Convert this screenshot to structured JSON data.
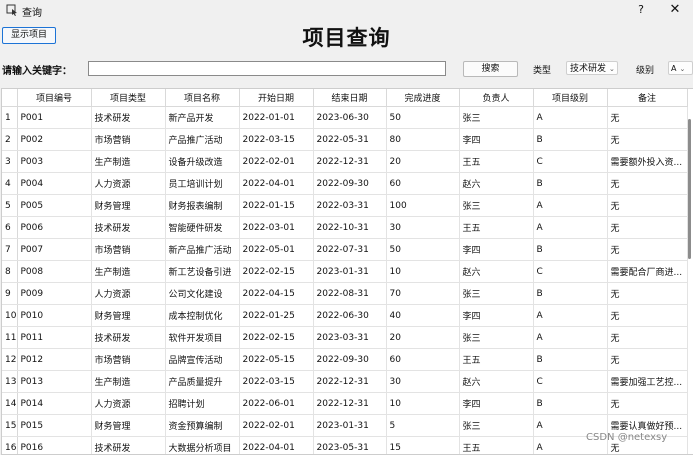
{
  "window": {
    "title": "查询",
    "help": "?",
    "close": "✕"
  },
  "toolbar": {
    "show_button": "显示项目",
    "page_title": "项目查询",
    "keyword_label": "请输入关键字：",
    "keyword_value": "",
    "search_button": "搜索",
    "type_label": "类型",
    "type_selected": "技术研发",
    "level_label": "级别",
    "level_selected": "A"
  },
  "table": {
    "columns": [
      "项目编号",
      "项目类型",
      "项目名称",
      "开始日期",
      "结束日期",
      "完成进度",
      "负责人",
      "项目级别",
      "备注"
    ],
    "rows": [
      [
        "1",
        "P001",
        "技术研发",
        "新产品开发",
        "2022-01-01",
        "2023-06-30",
        "50",
        "张三",
        "A",
        "无"
      ],
      [
        "2",
        "P002",
        "市场营销",
        "产品推广活动",
        "2022-03-15",
        "2022-05-31",
        "80",
        "李四",
        "B",
        "无"
      ],
      [
        "3",
        "P003",
        "生产制造",
        "设备升级改造",
        "2022-02-01",
        "2022-12-31",
        "20",
        "王五",
        "C",
        "需要额外投入资..."
      ],
      [
        "4",
        "P004",
        "人力资源",
        "员工培训计划",
        "2022-04-01",
        "2022-09-30",
        "60",
        "赵六",
        "B",
        "无"
      ],
      [
        "5",
        "P005",
        "财务管理",
        "财务报表编制",
        "2022-01-15",
        "2022-03-31",
        "100",
        "张三",
        "A",
        "无"
      ],
      [
        "6",
        "P006",
        "技术研发",
        "智能硬件研发",
        "2022-03-01",
        "2022-10-31",
        "30",
        "王五",
        "A",
        "无"
      ],
      [
        "7",
        "P007",
        "市场营销",
        "新产品推广活动",
        "2022-05-01",
        "2022-07-31",
        "50",
        "李四",
        "B",
        "无"
      ],
      [
        "8",
        "P008",
        "生产制造",
        "新工艺设备引进",
        "2022-02-15",
        "2023-01-31",
        "10",
        "赵六",
        "C",
        "需要配合厂商进..."
      ],
      [
        "9",
        "P009",
        "人力资源",
        "公司文化建设",
        "2022-04-15",
        "2022-08-31",
        "70",
        "张三",
        "B",
        "无"
      ],
      [
        "10",
        "P010",
        "财务管理",
        "成本控制优化",
        "2022-01-25",
        "2022-06-30",
        "40",
        "李四",
        "A",
        "无"
      ],
      [
        "11",
        "P011",
        "技术研发",
        "软件开发项目",
        "2022-02-15",
        "2023-03-31",
        "20",
        "张三",
        "A",
        "无"
      ],
      [
        "12",
        "P012",
        "市场营销",
        "品牌宣传活动",
        "2022-05-15",
        "2022-09-30",
        "60",
        "王五",
        "B",
        "无"
      ],
      [
        "13",
        "P013",
        "生产制造",
        "产品质量提升",
        "2022-03-15",
        "2022-12-31",
        "30",
        "赵六",
        "C",
        "需要加强工艺控..."
      ],
      [
        "14",
        "P014",
        "人力资源",
        "招聘计划",
        "2022-06-01",
        "2022-12-31",
        "10",
        "李四",
        "B",
        "无"
      ],
      [
        "15",
        "P015",
        "财务管理",
        "资金预算编制",
        "2022-02-01",
        "2023-01-31",
        "5",
        "张三",
        "A",
        "需要认真做好预..."
      ],
      [
        "16",
        "P016",
        "技术研发",
        "大数据分析项目",
        "2022-04-01",
        "2023-05-31",
        "15",
        "王五",
        "A",
        "无"
      ]
    ]
  },
  "watermark": "CSDN @netexsy"
}
